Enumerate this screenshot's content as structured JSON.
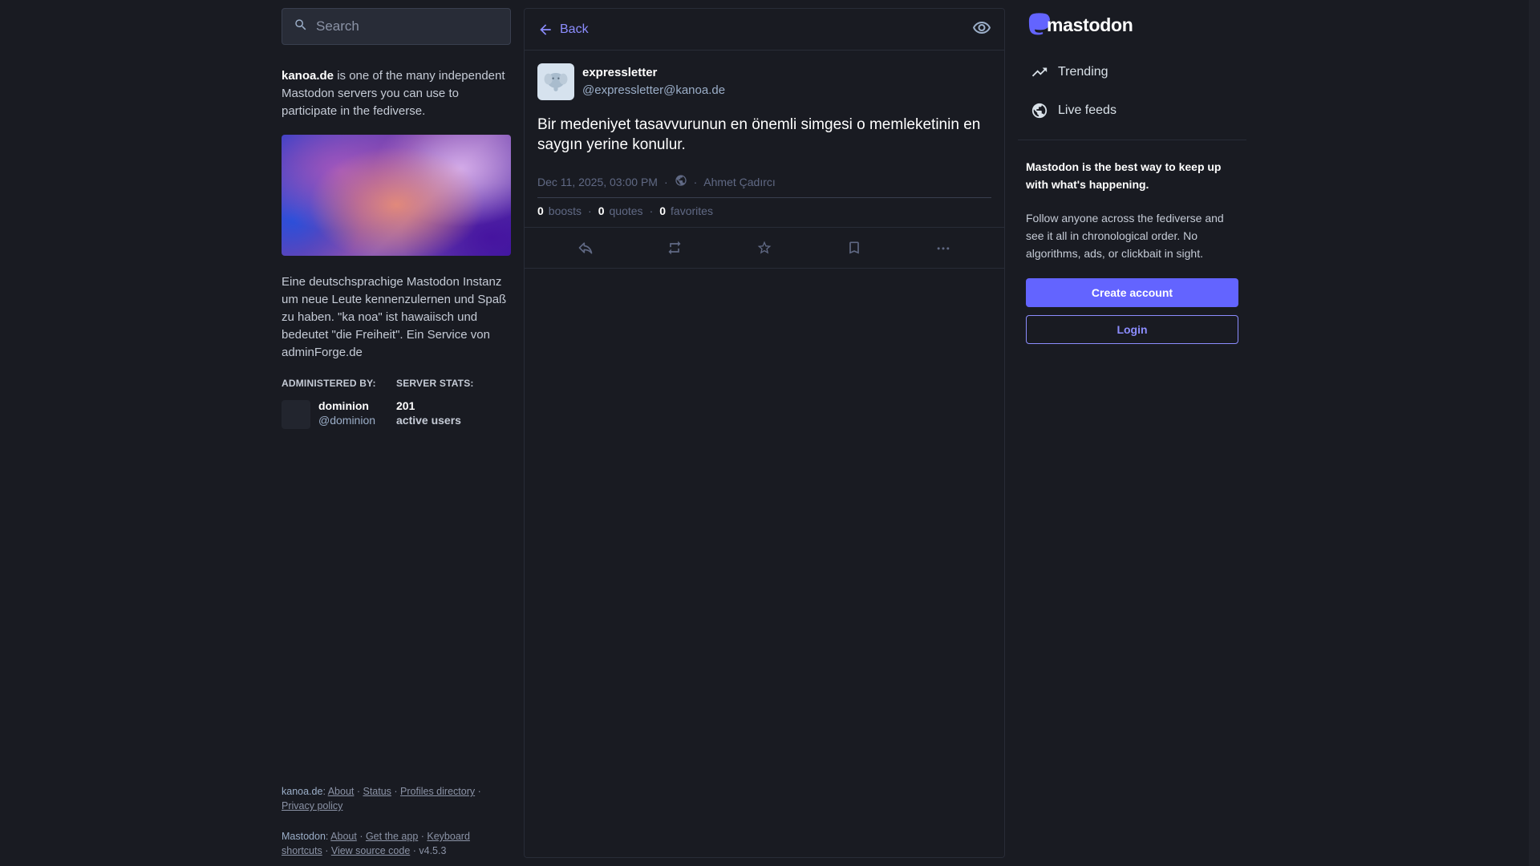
{
  "search": {
    "placeholder": "Search"
  },
  "server": {
    "domain": "kanoa.de",
    "intro_rest": " is one of the many independent Mastodon servers you can use to participate in the fediverse.",
    "description": "Eine deutschsprachige Mastodon Instanz um neue Leute kennenzulernen und Spaß zu haben. \"ka noa\" ist hawaiisch und bedeutet \"die Freiheit\". Ein Service von adminForge.de",
    "administered_label": "ADMINISTERED BY:",
    "stats_label": "SERVER STATS:",
    "admin_name": "dominion",
    "admin_handle": "@dominion",
    "active_users_count": "201",
    "active_users_label": "active users"
  },
  "footer": {
    "server_name": "kanoa.de",
    "server_links": [
      "About",
      "Status",
      "Profiles directory",
      "Privacy policy"
    ],
    "mastodon_name": "Mastodon",
    "mastodon_links": [
      "About",
      "Get the app",
      "Keyboard shortcuts",
      "View source code"
    ],
    "version": "v4.5.3"
  },
  "header": {
    "back_label": "Back"
  },
  "status": {
    "display_name": "expressletter",
    "acct": "@expressletter@kanoa.de",
    "content": "Bir medeniyet tasavvurunun en önemli simgesi o memleketinin en saygın yerine konulur.",
    "timestamp": "Dec 11, 2025, 03:00 PM",
    "visibility_icon": "globe-icon",
    "via_name": "Ahmet Çadırcı",
    "boosts_count": "0",
    "boosts_label": "boosts",
    "quotes_count": "0",
    "quotes_label": "quotes",
    "favorites_count": "0",
    "favorites_label": "favorites"
  },
  "brand": {
    "logo_text": "mastodon",
    "accent": "#6364ff",
    "link": "#8c8dff"
  },
  "nav": {
    "trending_label": "Trending",
    "live_feeds_label": "Live feeds"
  },
  "signup": {
    "title": "Mastodon is the best way to keep up with what's happening.",
    "text": "Follow anyone across the fediverse and see it all in chronological order. No algorithms, ads, or clickbait in sight.",
    "create_account_label": "Create account",
    "login_label": "Login"
  }
}
